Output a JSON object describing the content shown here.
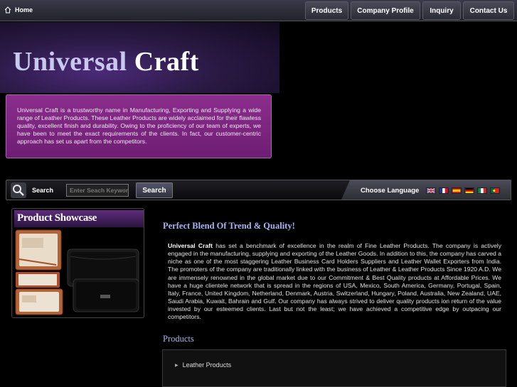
{
  "nav": {
    "home_label": "Home",
    "items": [
      "Products",
      "Company Profile",
      "Inquiry",
      "Contact Us"
    ]
  },
  "header": {
    "logo_part1": "Universal",
    "logo_part2": "Craft"
  },
  "intro": {
    "text": "Universal Craft is a trustworthy name in Manufacturing, Exporting and Supplying a wide range of Leather Products. These Leather Products are widely acclaimed for their flawless quality, excellent finish and durability. Owing to the proficiency of our team of experts, we have been to meet the exact requirements of the clients. In fact, our customer-centric approach has set us apart from the competitors."
  },
  "search": {
    "label": "Search",
    "placeholder": "Enter Seach Keyword",
    "button_label": "Search"
  },
  "language": {
    "label": "Choose Language",
    "flags": [
      "english-flag-icon",
      "french-flag-icon",
      "spanish-flag-icon",
      "german-flag-icon",
      "italian-flag-icon",
      "portuguese-flag-icon"
    ]
  },
  "showcase": {
    "title": "Product Showcase"
  },
  "main": {
    "title": "Perfect Blend Of Trend & Quality!",
    "company_name": "Universal Craft",
    "body": "has set a benchmark of excellence in the realm of Fine Leather Products. The company is actively engaged in the manufacturing, supplying and exporting of the Leather Goods. In addition to this, the company has carved a niche as one of the most staggering Leather Business Card Holders Suppliers and Leather Wallet Exporters from India. The promoters of the company are traditionally linked with the business of Leather & Leather Products Since 1920 A.D. We are immensely renowned in the global market due to our Commitment & Best Quality products at Affordable Prices. We have a huge clientele network that is spread in the regions of USA, Mexico, South America, Germany, Portugal, Spain, Italy, France, United Kingdom, Netherland, Denmark, Austria, Switzerland, Hungary, Poland, Australia, New Zealand, UAE, Saudi Arabia, Kuwait, Bahrain and Gulf. Our company has always strived to deliver quality products ion return of the value invested by our esteemed clients. Last but not the least; we have achieved a competitive edge by outpacing our competitors.",
    "products_title": "Products",
    "products": [
      "Leather Products"
    ]
  },
  "colors": {
    "accent_purple": "#7a2680",
    "heading_blue": "#a9b3f2"
  }
}
